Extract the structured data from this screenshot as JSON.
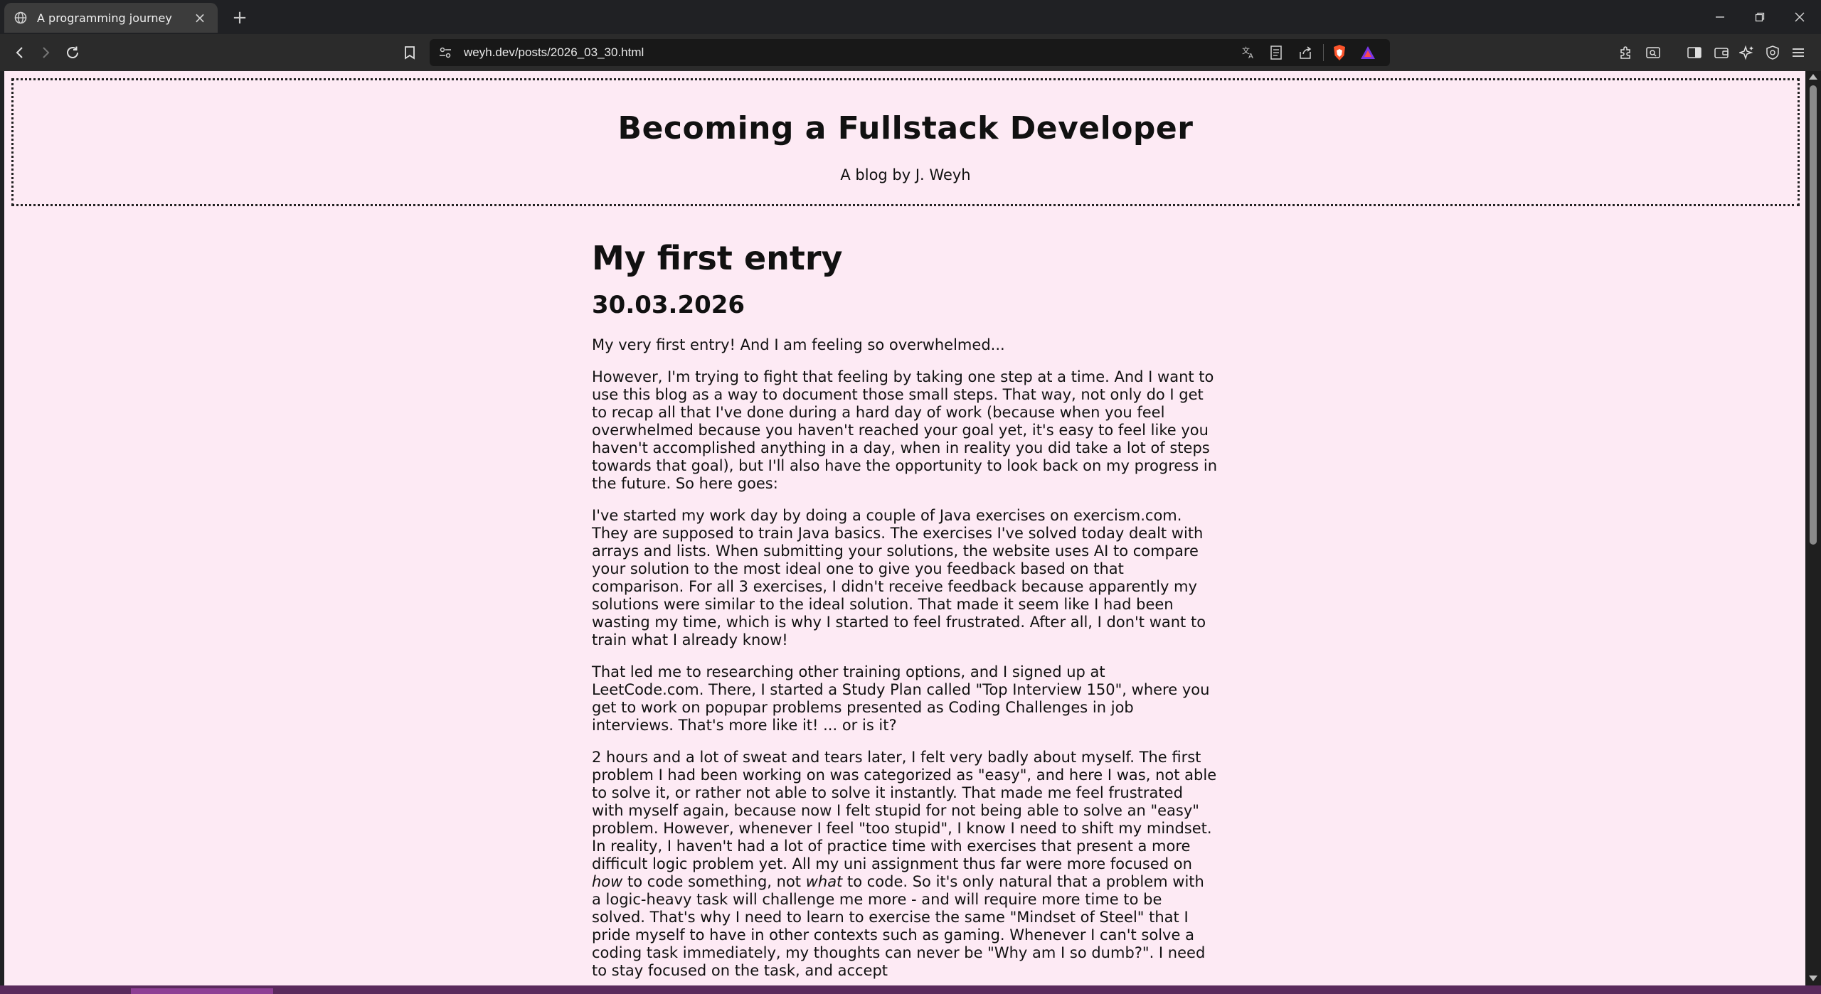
{
  "browser": {
    "tab_title": "A programming journey",
    "tab_close": "×",
    "new_tab": "+",
    "url": "weyh.dev/posts/2026_03_30.html"
  },
  "page": {
    "site_title": "Becoming a Fullstack Developer",
    "site_subtitle": "A blog by J. Weyh",
    "post_title": "My first entry",
    "post_date": "30.03.2026",
    "p1": "My very first entry! And I am feeling so overwhelmed...",
    "p2": "However, I'm trying to fight that feeling by taking one step at a time. And I want to use this blog as a way to document those small steps. That way, not only do I get to recap all that I've done during a hard day of work (because when you feel overwhelmed because you haven't reached your goal yet, it's easy to feel like you haven't accomplished anything in a day, when in reality you did take a lot of steps towards that goal), but I'll also have the opportunity to look back on my progress in the future. So here goes:",
    "p3": "I've started my work day by doing a couple of Java exercises on exercism.com. They are supposed to train Java basics. The exercises I've solved today dealt with arrays and lists. When submitting your solutions, the website uses AI to compare your solution to the most ideal one to give you feedback based on that comparison. For all 3 exercises, I didn't receive feedback because apparently my solutions were similar to the ideal solution. That made it seem like I had been wasting my time, which is why I started to feel frustrated. After all, I don't want to train what I already know!",
    "p4": "That led me to researching other training options, and I signed up at LeetCode.com. There, I started a Study Plan called \"Top Interview 150\", where you get to work on popupar problems presented as Coding Challenges in job interviews. That's more like it! ... or is it?",
    "p5_a": "2 hours and a lot of sweat and tears later, I felt very badly about myself. The first problem I had been working on was categorized as \"easy\", and here I was, not able to solve it, or rather not able to solve it instantly. That made me feel frustrated with myself again, because now I felt stupid for not being able to solve an \"easy\" problem. However, whenever I feel \"too stupid\", I know I need to shift my mindset. In reality, I haven't had a lot of practice time with exercises that present a more difficult logic problem yet. All my uni assignment thus far were more focused on ",
    "p5_em1": "how",
    "p5_b": " to code something, not ",
    "p5_em2": "what",
    "p5_c": " to code. So it's only natural that a problem with a logic-heavy task will challenge me more - and will require more time to be solved. That's why I need to learn to exercise the same \"Mindset of Steel\" that I pride myself to have in other contexts such as gaming. Whenever I can't solve a coding task immediately, my thoughts can never be \"Why am I so dumb?\". I need to stay focused on the task, and accept"
  }
}
